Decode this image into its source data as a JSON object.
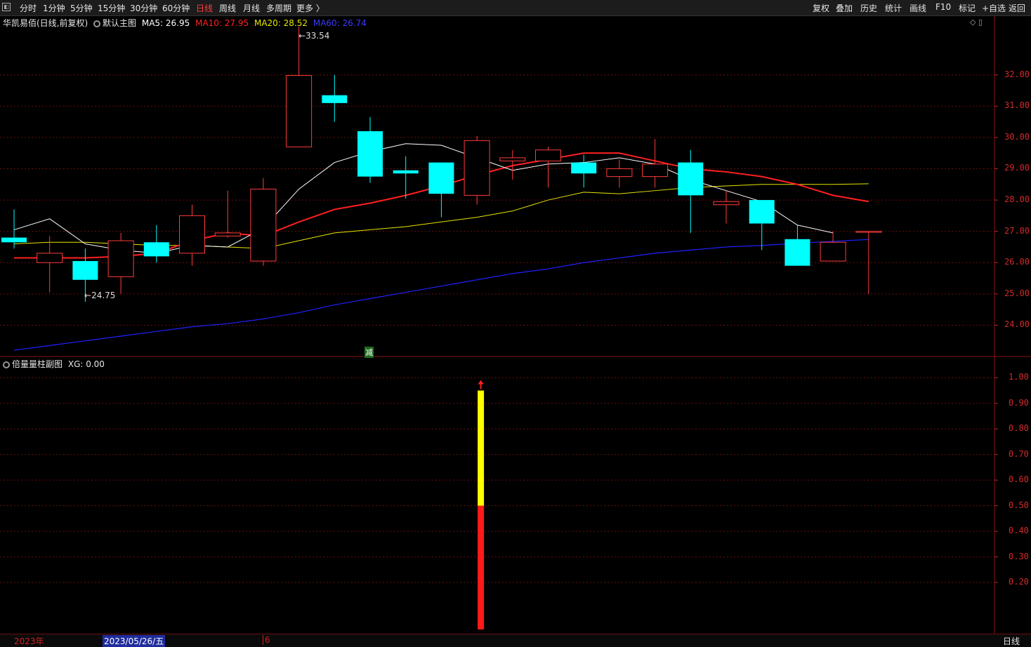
{
  "toolbar": {
    "left": [
      "分时",
      "1分钟",
      "5分钟",
      "15分钟",
      "30分钟",
      "60分钟",
      "日线",
      "周线",
      "月线",
      "多周期",
      "更多 〉"
    ],
    "active": "日线",
    "right": [
      "复权",
      "叠加",
      "历史",
      "统计",
      "画线",
      "F10",
      "标记",
      "+自选",
      "返回"
    ]
  },
  "main_panel": {
    "stock_title": "华凯易佰(日线,前复权)",
    "indicator_name": "默认主图",
    "ma5_label": "MA5: 26.95",
    "ma10_label": "MA10: 27.95",
    "ma20_label": "MA20: 28.52",
    "ma60_label": "MA60: 26.74",
    "high_label": "33.54",
    "low_label": "24.75",
    "marker_text": "减",
    "y_ticks": [
      "32.00",
      "31.00",
      "30.00",
      "29.00",
      "28.00",
      "27.00",
      "26.00",
      "25.00",
      "24.00"
    ]
  },
  "sub_panel": {
    "title": "倍量量柱副图",
    "value_label": "XG: 0.00",
    "y_ticks": [
      "1.00",
      "0.90",
      "0.80",
      "0.70",
      "0.60",
      "0.50",
      "0.40",
      "0.30",
      "0.20"
    ]
  },
  "bottom": {
    "year": "2023年",
    "selected_date": "2023/05/26/五",
    "month_mark": "6",
    "period": "日线"
  },
  "colors": {
    "up": "#ff3b3b",
    "down": "#00ffff",
    "ma5": "#ffffff",
    "ma10": "#ff2020",
    "ma20": "#e6e600",
    "ma60": "#2020ff",
    "grid": "#6a0f0f"
  },
  "chart_data": {
    "type": "candlestick",
    "candles": [
      {
        "o": 26.8,
        "h": 27.7,
        "l": 26.45,
        "c": 26.65
      },
      {
        "o": 26.0,
        "h": 26.85,
        "l": 25.05,
        "c": 26.3
      },
      {
        "o": 26.05,
        "h": 26.45,
        "l": 24.75,
        "c": 25.45
      },
      {
        "o": 25.55,
        "h": 26.95,
        "l": 25.0,
        "c": 26.7
      },
      {
        "o": 26.65,
        "h": 27.2,
        "l": 26.0,
        "c": 26.2
      },
      {
        "o": 26.3,
        "h": 27.85,
        "l": 25.9,
        "c": 27.5
      },
      {
        "o": 26.85,
        "h": 28.3,
        "l": 26.8,
        "c": 26.95
      },
      {
        "o": 26.05,
        "h": 28.7,
        "l": 25.9,
        "c": 28.35
      },
      {
        "o": 29.7,
        "h": 33.54,
        "l": 29.7,
        "c": 31.98
      },
      {
        "o": 31.35,
        "h": 32.0,
        "l": 30.5,
        "c": 31.1
      },
      {
        "o": 30.2,
        "h": 30.65,
        "l": 28.55,
        "c": 28.75
      },
      {
        "o": 28.95,
        "h": 29.4,
        "l": 28.05,
        "c": 28.85
      },
      {
        "o": 29.2,
        "h": 29.2,
        "l": 27.45,
        "c": 28.2
      },
      {
        "o": 28.15,
        "h": 30.05,
        "l": 27.85,
        "c": 29.9
      },
      {
        "o": 29.25,
        "h": 29.6,
        "l": 28.65,
        "c": 29.35
      },
      {
        "o": 29.25,
        "h": 29.7,
        "l": 28.4,
        "c": 29.6
      },
      {
        "o": 29.2,
        "h": 29.45,
        "l": 28.4,
        "c": 28.85
      },
      {
        "o": 28.75,
        "h": 29.3,
        "l": 28.4,
        "c": 29.0
      },
      {
        "o": 28.75,
        "h": 29.95,
        "l": 28.4,
        "c": 29.15
      },
      {
        "o": 29.2,
        "h": 29.6,
        "l": 26.95,
        "c": 28.15
      },
      {
        "o": 27.85,
        "h": 28.3,
        "l": 27.25,
        "c": 27.95
      },
      {
        "o": 28.0,
        "h": 28.0,
        "l": 26.4,
        "c": 27.25
      },
      {
        "o": 26.75,
        "h": 27.2,
        "l": 25.9,
        "c": 25.9
      },
      {
        "o": 26.05,
        "h": 27.0,
        "l": 26.05,
        "c": 26.65
      },
      {
        "o": 27.0,
        "h": 27.0,
        "l": 25.0,
        "c": 27.0
      }
    ],
    "ma5": [
      27.05,
      27.4,
      26.6,
      26.4,
      26.3,
      26.55,
      26.5,
      27.1,
      28.35,
      29.2,
      29.55,
      29.8,
      29.75,
      29.35,
      28.95,
      29.15,
      29.2,
      29.35,
      29.15,
      28.65,
      28.3,
      27.95,
      27.2,
      26.95
    ],
    "ma10": [
      26.15,
      26.15,
      26.15,
      26.2,
      26.3,
      26.7,
      26.95,
      26.85,
      27.3,
      27.7,
      27.9,
      28.15,
      28.45,
      28.8,
      29.1,
      29.3,
      29.5,
      29.5,
      29.25,
      29.0,
      28.9,
      28.75,
      28.5,
      28.15,
      27.95
    ],
    "ma20": [
      26.6,
      26.65,
      26.65,
      26.6,
      26.55,
      26.55,
      26.5,
      26.45,
      26.7,
      26.95,
      27.05,
      27.15,
      27.3,
      27.45,
      27.65,
      28.0,
      28.25,
      28.2,
      28.3,
      28.4,
      28.45,
      28.5,
      28.5,
      28.5,
      28.52
    ],
    "ma60": [
      23.2,
      23.35,
      23.5,
      23.65,
      23.8,
      23.95,
      24.05,
      24.2,
      24.4,
      24.65,
      24.85,
      25.05,
      25.25,
      25.45,
      25.65,
      25.8,
      26.0,
      26.15,
      26.3,
      26.4,
      26.5,
      26.55,
      26.62,
      26.68,
      26.74
    ],
    "price_ylim": [
      23.0,
      33.9
    ],
    "sub_ylim": [
      0.0,
      1.05
    ],
    "volume_bar": {
      "index": 13,
      "total": 0.95,
      "red_part": 0.5,
      "yellow_part": 0.45,
      "arrow": true
    }
  }
}
